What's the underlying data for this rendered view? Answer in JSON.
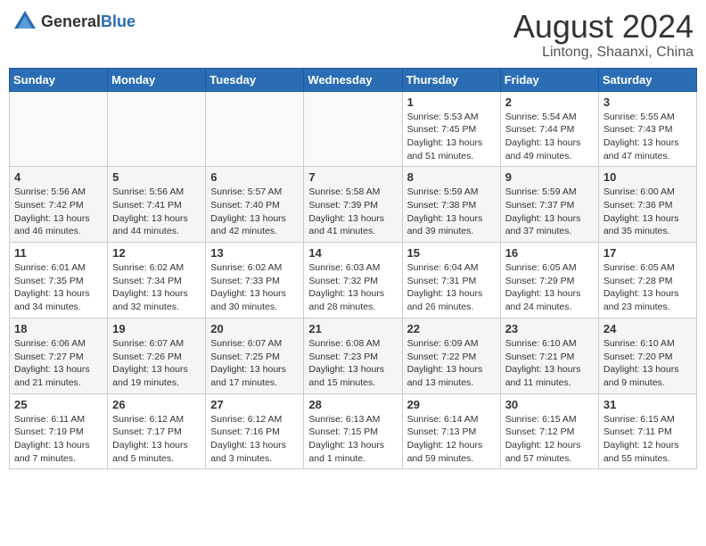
{
  "header": {
    "logo_general": "General",
    "logo_blue": "Blue",
    "month": "August 2024",
    "location": "Lintong, Shaanxi, China"
  },
  "weekdays": [
    "Sunday",
    "Monday",
    "Tuesday",
    "Wednesday",
    "Thursday",
    "Friday",
    "Saturday"
  ],
  "weeks": [
    [
      {
        "day": "",
        "detail": ""
      },
      {
        "day": "",
        "detail": ""
      },
      {
        "day": "",
        "detail": ""
      },
      {
        "day": "",
        "detail": ""
      },
      {
        "day": "1",
        "detail": "Sunrise: 5:53 AM\nSunset: 7:45 PM\nDaylight: 13 hours\nand 51 minutes."
      },
      {
        "day": "2",
        "detail": "Sunrise: 5:54 AM\nSunset: 7:44 PM\nDaylight: 13 hours\nand 49 minutes."
      },
      {
        "day": "3",
        "detail": "Sunrise: 5:55 AM\nSunset: 7:43 PM\nDaylight: 13 hours\nand 47 minutes."
      }
    ],
    [
      {
        "day": "4",
        "detail": "Sunrise: 5:56 AM\nSunset: 7:42 PM\nDaylight: 13 hours\nand 46 minutes."
      },
      {
        "day": "5",
        "detail": "Sunrise: 5:56 AM\nSunset: 7:41 PM\nDaylight: 13 hours\nand 44 minutes."
      },
      {
        "day": "6",
        "detail": "Sunrise: 5:57 AM\nSunset: 7:40 PM\nDaylight: 13 hours\nand 42 minutes."
      },
      {
        "day": "7",
        "detail": "Sunrise: 5:58 AM\nSunset: 7:39 PM\nDaylight: 13 hours\nand 41 minutes."
      },
      {
        "day": "8",
        "detail": "Sunrise: 5:59 AM\nSunset: 7:38 PM\nDaylight: 13 hours\nand 39 minutes."
      },
      {
        "day": "9",
        "detail": "Sunrise: 5:59 AM\nSunset: 7:37 PM\nDaylight: 13 hours\nand 37 minutes."
      },
      {
        "day": "10",
        "detail": "Sunrise: 6:00 AM\nSunset: 7:36 PM\nDaylight: 13 hours\nand 35 minutes."
      }
    ],
    [
      {
        "day": "11",
        "detail": "Sunrise: 6:01 AM\nSunset: 7:35 PM\nDaylight: 13 hours\nand 34 minutes."
      },
      {
        "day": "12",
        "detail": "Sunrise: 6:02 AM\nSunset: 7:34 PM\nDaylight: 13 hours\nand 32 minutes."
      },
      {
        "day": "13",
        "detail": "Sunrise: 6:02 AM\nSunset: 7:33 PM\nDaylight: 13 hours\nand 30 minutes."
      },
      {
        "day": "14",
        "detail": "Sunrise: 6:03 AM\nSunset: 7:32 PM\nDaylight: 13 hours\nand 28 minutes."
      },
      {
        "day": "15",
        "detail": "Sunrise: 6:04 AM\nSunset: 7:31 PM\nDaylight: 13 hours\nand 26 minutes."
      },
      {
        "day": "16",
        "detail": "Sunrise: 6:05 AM\nSunset: 7:29 PM\nDaylight: 13 hours\nand 24 minutes."
      },
      {
        "day": "17",
        "detail": "Sunrise: 6:05 AM\nSunset: 7:28 PM\nDaylight: 13 hours\nand 23 minutes."
      }
    ],
    [
      {
        "day": "18",
        "detail": "Sunrise: 6:06 AM\nSunset: 7:27 PM\nDaylight: 13 hours\nand 21 minutes."
      },
      {
        "day": "19",
        "detail": "Sunrise: 6:07 AM\nSunset: 7:26 PM\nDaylight: 13 hours\nand 19 minutes."
      },
      {
        "day": "20",
        "detail": "Sunrise: 6:07 AM\nSunset: 7:25 PM\nDaylight: 13 hours\nand 17 minutes."
      },
      {
        "day": "21",
        "detail": "Sunrise: 6:08 AM\nSunset: 7:23 PM\nDaylight: 13 hours\nand 15 minutes."
      },
      {
        "day": "22",
        "detail": "Sunrise: 6:09 AM\nSunset: 7:22 PM\nDaylight: 13 hours\nand 13 minutes."
      },
      {
        "day": "23",
        "detail": "Sunrise: 6:10 AM\nSunset: 7:21 PM\nDaylight: 13 hours\nand 11 minutes."
      },
      {
        "day": "24",
        "detail": "Sunrise: 6:10 AM\nSunset: 7:20 PM\nDaylight: 13 hours\nand 9 minutes."
      }
    ],
    [
      {
        "day": "25",
        "detail": "Sunrise: 6:11 AM\nSunset: 7:19 PM\nDaylight: 13 hours\nand 7 minutes."
      },
      {
        "day": "26",
        "detail": "Sunrise: 6:12 AM\nSunset: 7:17 PM\nDaylight: 13 hours\nand 5 minutes."
      },
      {
        "day": "27",
        "detail": "Sunrise: 6:12 AM\nSunset: 7:16 PM\nDaylight: 13 hours\nand 3 minutes."
      },
      {
        "day": "28",
        "detail": "Sunrise: 6:13 AM\nSunset: 7:15 PM\nDaylight: 13 hours\nand 1 minute."
      },
      {
        "day": "29",
        "detail": "Sunrise: 6:14 AM\nSunset: 7:13 PM\nDaylight: 12 hours\nand 59 minutes."
      },
      {
        "day": "30",
        "detail": "Sunrise: 6:15 AM\nSunset: 7:12 PM\nDaylight: 12 hours\nand 57 minutes."
      },
      {
        "day": "31",
        "detail": "Sunrise: 6:15 AM\nSunset: 7:11 PM\nDaylight: 12 hours\nand 55 minutes."
      }
    ]
  ]
}
